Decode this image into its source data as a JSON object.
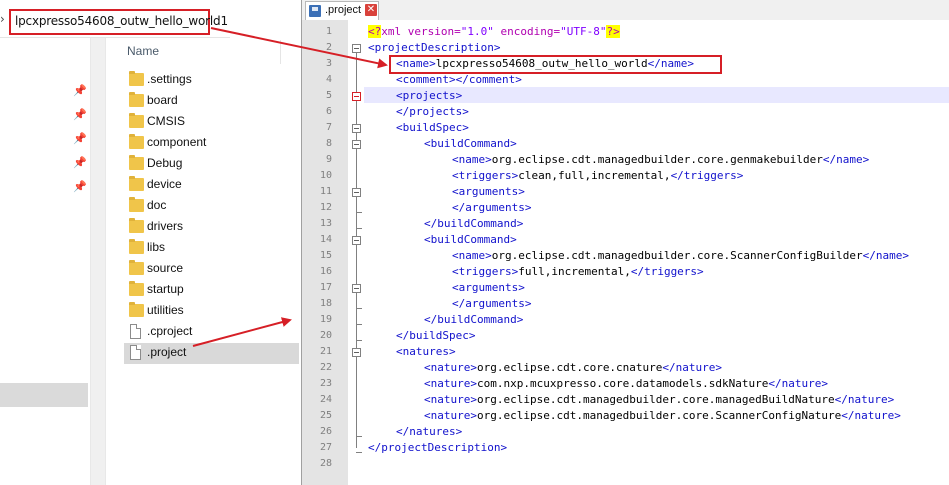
{
  "explorer": {
    "address": "lpcxpresso54608_outw_hello_world1",
    "address_chevron": "›",
    "column_header": "Name",
    "items": [
      {
        "name": ".settings",
        "type": "folder"
      },
      {
        "name": "board",
        "type": "folder"
      },
      {
        "name": "CMSIS",
        "type": "folder"
      },
      {
        "name": "component",
        "type": "folder"
      },
      {
        "name": "Debug",
        "type": "folder"
      },
      {
        "name": "device",
        "type": "folder"
      },
      {
        "name": "doc",
        "type": "folder"
      },
      {
        "name": "drivers",
        "type": "folder"
      },
      {
        "name": "libs",
        "type": "folder"
      },
      {
        "name": "source",
        "type": "folder"
      },
      {
        "name": "startup",
        "type": "folder"
      },
      {
        "name": "utilities",
        "type": "folder"
      },
      {
        "name": ".cproject",
        "type": "file"
      },
      {
        "name": ".project",
        "type": "file",
        "selected": true
      }
    ],
    "pin_icon": "pin-icon"
  },
  "editor": {
    "tab_label": ".project",
    "tab_close": "✕",
    "lines": [
      {
        "n": "1"
      },
      {
        "n": "2"
      },
      {
        "n": "3"
      },
      {
        "n": "4"
      },
      {
        "n": "5"
      },
      {
        "n": "6"
      },
      {
        "n": "7"
      },
      {
        "n": "8"
      },
      {
        "n": "9"
      },
      {
        "n": "10"
      },
      {
        "n": "11"
      },
      {
        "n": "12"
      },
      {
        "n": "13"
      },
      {
        "n": "14"
      },
      {
        "n": "15"
      },
      {
        "n": "16"
      },
      {
        "n": "17"
      },
      {
        "n": "18"
      },
      {
        "n": "19"
      },
      {
        "n": "20"
      },
      {
        "n": "21"
      },
      {
        "n": "22"
      },
      {
        "n": "23"
      },
      {
        "n": "24"
      },
      {
        "n": "25"
      },
      {
        "n": "26"
      },
      {
        "n": "27"
      },
      {
        "n": "28"
      }
    ],
    "code": {
      "l1_open": "<?",
      "l1_mid": "xml version=",
      "l1_v1": "\"1.0\"",
      "l1_enc": " encoding=",
      "l1_v2": "\"UTF-8\"",
      "l1_close": "?>",
      "l2": "<projectDescription>",
      "l3_open": "<name>",
      "l3_text": "lpcxpresso54608_outw_hello_world",
      "l3_close": "</name>",
      "l4": "<comment></comment>",
      "l5": "<projects>",
      "l6": "</projects>",
      "l7": "<buildSpec>",
      "l8": "<buildCommand>",
      "l9_open": "<name>",
      "l9_text": "org.eclipse.cdt.managedbuilder.core.genmakebuilder",
      "l9_close": "</name>",
      "l10_open": "<triggers>",
      "l10_text": "clean,full,incremental,",
      "l10_close": "</triggers>",
      "l11": "<arguments>",
      "l12": "</arguments>",
      "l13": "</buildCommand>",
      "l14": "<buildCommand>",
      "l15_open": "<name>",
      "l15_text": "org.eclipse.cdt.managedbuilder.core.ScannerConfigBuilder",
      "l15_close": "</name>",
      "l16_open": "<triggers>",
      "l16_text": "full,incremental,",
      "l16_close": "</triggers>",
      "l17": "<arguments>",
      "l18": "</arguments>",
      "l19": "</buildCommand>",
      "l20": "</buildSpec>",
      "l21": "<natures>",
      "l22_open": "<nature>",
      "l22_text": "org.eclipse.cdt.core.cnature",
      "l22_close": "</nature>",
      "l23_open": "<nature>",
      "l23_text": "com.nxp.mcuxpresso.core.datamodels.sdkNature",
      "l23_close": "</nature>",
      "l24_open": "<nature>",
      "l24_text": "org.eclipse.cdt.managedbuilder.core.managedBuildNature",
      "l24_close": "</nature>",
      "l25_open": "<nature>",
      "l25_text": "org.eclipse.cdt.managedbuilder.core.ScannerConfigNature",
      "l25_close": "</nature>",
      "l26": "</natures>",
      "l27": "</projectDescription>"
    }
  },
  "colors": {
    "annotation_red": "#d61f26",
    "xml_tag": "#1111cc",
    "current_line": "#e8e8ff"
  }
}
